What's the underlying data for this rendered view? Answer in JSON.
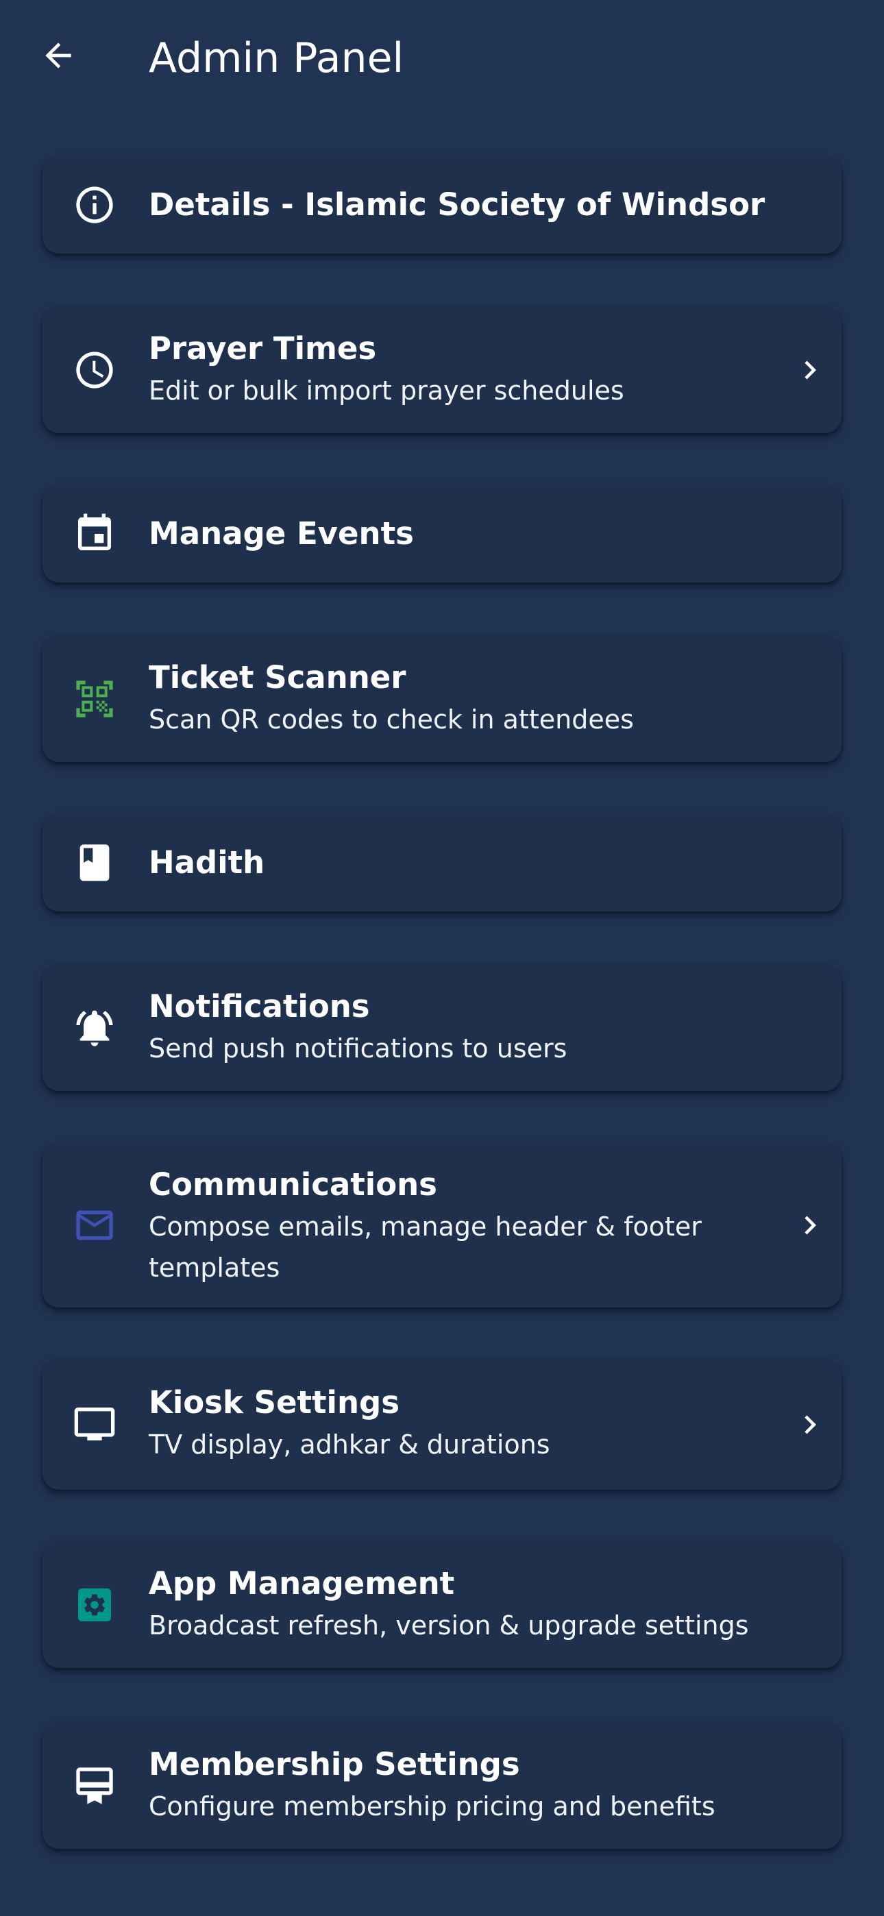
{
  "header": {
    "title": "Admin Panel",
    "back_icon": "arrow-left-icon"
  },
  "colors": {
    "background": "#203352",
    "card": "#1e304c",
    "text": "#ffffff",
    "qr_icon": "#4caf50",
    "mail_icon": "#3f51b5",
    "app_management_icon": "#009688"
  },
  "menu": [
    {
      "title": "Details - Islamic Society of Windsor",
      "icon": "info-icon"
    },
    {
      "title": "Prayer Times",
      "subtitle": "Edit or bulk import prayer schedules",
      "icon": "clock-icon",
      "chevron": true
    },
    {
      "title": "Manage Events",
      "icon": "calendar-icon"
    },
    {
      "title": "Ticket Scanner",
      "subtitle": "Scan QR codes to check in attendees",
      "icon": "qr-code-scanner-icon"
    },
    {
      "title": "Hadith",
      "icon": "book-icon"
    },
    {
      "title": "Notifications",
      "subtitle": "Send push notifications to users",
      "icon": "notification-bell-icon"
    },
    {
      "title": "Communications",
      "subtitle": "Compose emails, manage header & footer templates",
      "icon": "mail-icon",
      "chevron": true
    },
    {
      "title": "Kiosk Settings",
      "subtitle": "TV display, adhkar & durations",
      "icon": "tv-icon",
      "chevron": true
    },
    {
      "title": "App Management",
      "subtitle": "Broadcast refresh, version & upgrade settings",
      "icon": "settings-app-icon"
    },
    {
      "title": "Membership Settings",
      "subtitle": "Configure membership pricing and benefits",
      "icon": "membership-card-icon"
    }
  ]
}
